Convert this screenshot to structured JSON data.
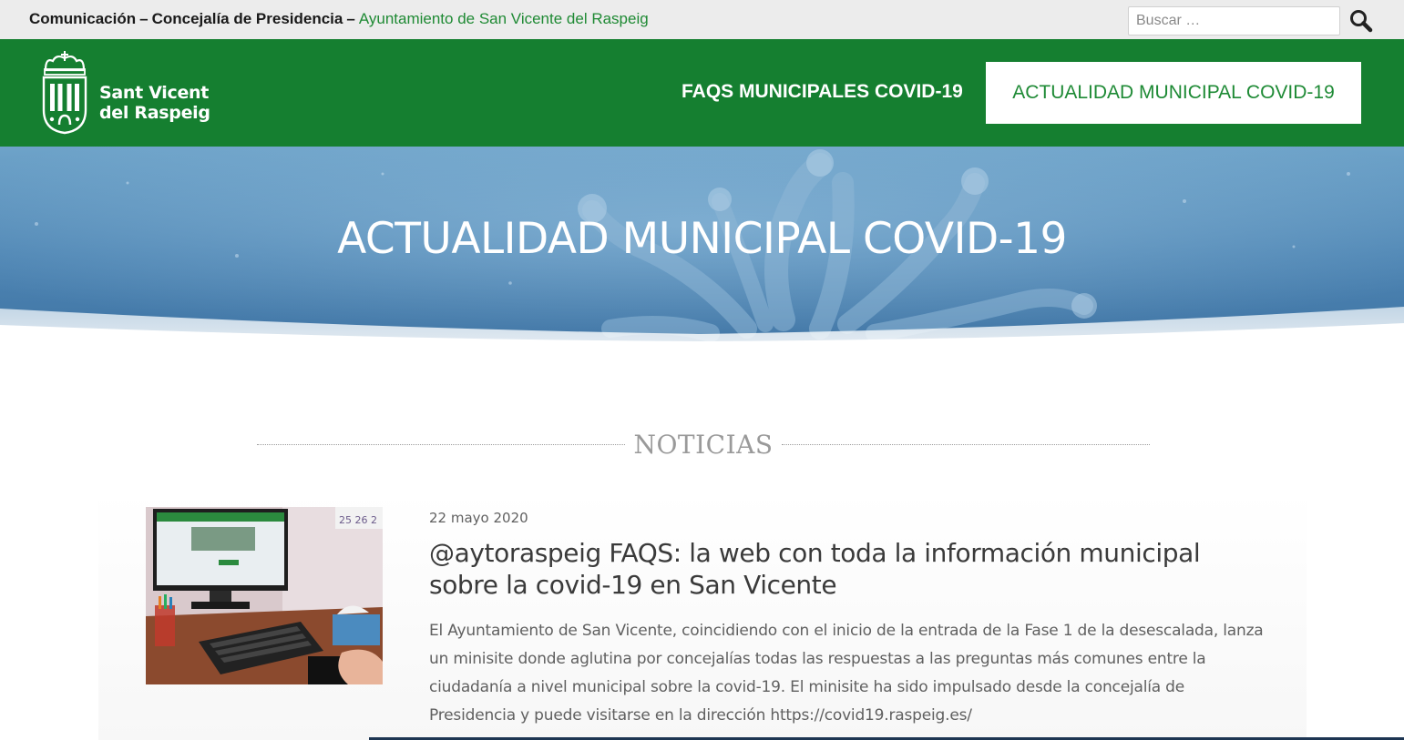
{
  "topbar": {
    "section_name": "Comunicación",
    "separator": "–",
    "department": "Concejalía de Presidencia",
    "organization": "Ayuntamiento de San Vicente del Raspeig",
    "search_placeholder": "Buscar …",
    "search_icon": "search-icon"
  },
  "header": {
    "logo_line1": "Sant Vicent",
    "logo_line2": "del Raspeig",
    "nav": [
      {
        "label": "FAQS MUNICIPALES COVID-19",
        "active": false
      },
      {
        "label": "ACTUALIDAD MUNICIPAL COVID-19",
        "active": true
      }
    ],
    "brand_color": "#157f30"
  },
  "hero": {
    "title": "ACTUALIDAD MUNICIPAL COVID-19"
  },
  "news": {
    "heading": "NOTICIAS",
    "posts": [
      {
        "date": "22 mayo 2020",
        "title": "@aytoraspeig FAQS: la web con toda la información municipal sobre la covid-19 en San Vicente",
        "excerpt": "El Ayuntamiento de San Vicente, coincidiendo con el inicio de la entrada de la Fase 1 de la desescalada, lanza un minisite donde aglutina por concejalías todas las respuestas a las preguntas más comunes entre la ciudadanía a nivel municipal sobre la covid-19. El minisite ha sido impulsado desde la concejalía de Presidencia y puede visitarse en la dirección https://covid19.raspeig.es/"
      }
    ]
  }
}
